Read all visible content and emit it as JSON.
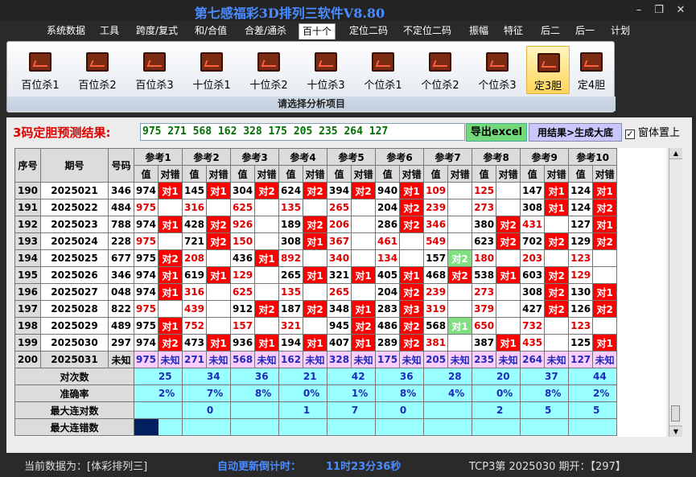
{
  "window": {
    "title": "第七感福彩3D排列三软件V8.80",
    "minimize": "–",
    "maximize": "❐",
    "close": "✕"
  },
  "menu": [
    "系统数据",
    "工具",
    "跨度/复式",
    "和/合值",
    "合差/通杀",
    "百十个",
    "定位二码",
    "不定位二码",
    "振幅",
    "特征",
    "后二",
    "后一",
    "计划"
  ],
  "menu_active": "百十个",
  "ribbon": {
    "buttons": [
      "百位杀1",
      "百位杀2",
      "百位杀3",
      "十位杀1",
      "十位杀2",
      "十位杀3",
      "个位杀1",
      "个位杀2",
      "个位杀3",
      "定3胆",
      "定4胆"
    ],
    "selected": "定3胆",
    "group_label": "请选择分析项目"
  },
  "result": {
    "label": "3码定胆预测结果:",
    "value": "975 271 568 162 328 175 205 235 264 127",
    "excel_button": "导出excel",
    "gen_button": "用结果>生成大底",
    "topmost_label": "窗体置上",
    "topmost_checked": "✓"
  },
  "table": {
    "header_top": [
      "序号",
      "期号",
      "号码",
      "参考1",
      "参考2",
      "参考3",
      "参考4",
      "参考5",
      "参考6",
      "参考7",
      "参考8",
      "参考9",
      "参考10"
    ],
    "header_sub": [
      "值",
      "对错"
    ],
    "rows": [
      {
        "seq": "190",
        "issue": "2025021",
        "num": "346",
        "refs": [
          [
            "974",
            "对1"
          ],
          [
            "145",
            "对1"
          ],
          [
            "304",
            "对2"
          ],
          [
            "624",
            "对2"
          ],
          [
            "394",
            "对2"
          ],
          [
            "940",
            "对1"
          ],
          [
            "109",
            ""
          ],
          [
            "125",
            ""
          ],
          [
            "147",
            "对1"
          ],
          [
            "124",
            "对1"
          ]
        ]
      },
      {
        "seq": "191",
        "issue": "2025022",
        "num": "484",
        "refs": [
          [
            "975",
            ""
          ],
          [
            "316",
            ""
          ],
          [
            "625",
            ""
          ],
          [
            "135",
            ""
          ],
          [
            "265",
            ""
          ],
          [
            "204",
            "对2"
          ],
          [
            "239",
            ""
          ],
          [
            "273",
            ""
          ],
          [
            "308",
            "对1"
          ],
          [
            "124",
            "对2"
          ]
        ]
      },
      {
        "seq": "192",
        "issue": "2025023",
        "num": "788",
        "refs": [
          [
            "974",
            "对1"
          ],
          [
            "428",
            "对2"
          ],
          [
            "926",
            ""
          ],
          [
            "189",
            "对2"
          ],
          [
            "206",
            ""
          ],
          [
            "286",
            "对2"
          ],
          [
            "346",
            ""
          ],
          [
            "380",
            "对2"
          ],
          [
            "431",
            ""
          ],
          [
            "127",
            "对1"
          ]
        ]
      },
      {
        "seq": "193",
        "issue": "2025024",
        "num": "228",
        "refs": [
          [
            "975",
            ""
          ],
          [
            "721",
            "对2"
          ],
          [
            "150",
            ""
          ],
          [
            "308",
            "对1"
          ],
          [
            "367",
            ""
          ],
          [
            "461",
            ""
          ],
          [
            "549",
            ""
          ],
          [
            "623",
            "对2"
          ],
          [
            "702",
            "对2"
          ],
          [
            "129",
            "对2"
          ]
        ]
      },
      {
        "seq": "194",
        "issue": "2025025",
        "num": "677",
        "refs": [
          [
            "975",
            "对2"
          ],
          [
            "208",
            ""
          ],
          [
            "436",
            "对1"
          ],
          [
            "892",
            ""
          ],
          [
            "340",
            ""
          ],
          [
            "134",
            ""
          ],
          [
            "157",
            "对2"
          ],
          [
            "180",
            ""
          ],
          [
            "203",
            ""
          ],
          [
            "123",
            ""
          ]
        ]
      },
      {
        "seq": "195",
        "issue": "2025026",
        "num": "346",
        "refs": [
          [
            "974",
            "对1"
          ],
          [
            "619",
            "对1"
          ],
          [
            "129",
            ""
          ],
          [
            "265",
            "对1"
          ],
          [
            "321",
            "对1"
          ],
          [
            "405",
            "对1"
          ],
          [
            "468",
            "对2"
          ],
          [
            "538",
            "对1"
          ],
          [
            "603",
            "对2"
          ],
          [
            "129",
            ""
          ]
        ]
      },
      {
        "seq": "196",
        "issue": "2025027",
        "num": "048",
        "refs": [
          [
            "974",
            "对1"
          ],
          [
            "316",
            ""
          ],
          [
            "625",
            ""
          ],
          [
            "135",
            ""
          ],
          [
            "265",
            ""
          ],
          [
            "204",
            "对2"
          ],
          [
            "239",
            ""
          ],
          [
            "273",
            ""
          ],
          [
            "308",
            "对2"
          ],
          [
            "130",
            "对1"
          ]
        ]
      },
      {
        "seq": "197",
        "issue": "2025028",
        "num": "822",
        "refs": [
          [
            "975",
            ""
          ],
          [
            "439",
            ""
          ],
          [
            "912",
            "对2"
          ],
          [
            "187",
            "对2"
          ],
          [
            "348",
            "对1"
          ],
          [
            "283",
            "对3"
          ],
          [
            "319",
            ""
          ],
          [
            "379",
            ""
          ],
          [
            "427",
            "对2"
          ],
          [
            "126",
            "对2"
          ]
        ]
      },
      {
        "seq": "198",
        "issue": "2025029",
        "num": "489",
        "refs": [
          [
            "975",
            "对1"
          ],
          [
            "752",
            ""
          ],
          [
            "157",
            ""
          ],
          [
            "321",
            ""
          ],
          [
            "945",
            "对2"
          ],
          [
            "486",
            "对2"
          ],
          [
            "568",
            "对1"
          ],
          [
            "650",
            ""
          ],
          [
            "732",
            ""
          ],
          [
            "123",
            ""
          ]
        ]
      },
      {
        "seq": "199",
        "issue": "2025030",
        "num": "297",
        "refs": [
          [
            "974",
            "对2"
          ],
          [
            "473",
            "对1"
          ],
          [
            "936",
            "对1"
          ],
          [
            "194",
            "对1"
          ],
          [
            "407",
            "对1"
          ],
          [
            "289",
            "对2"
          ],
          [
            "381",
            ""
          ],
          [
            "387",
            "对1"
          ],
          [
            "435",
            ""
          ],
          [
            "125",
            "对1"
          ]
        ]
      }
    ],
    "hit_colors": {
      "red": "#ff0000",
      "green": "#7ee07e"
    },
    "green_cells": [
      [
        4,
        6
      ],
      [
        8,
        6
      ]
    ],
    "prediction": {
      "seq": "200",
      "issue": "2025031",
      "num": "未知",
      "refs": [
        "975",
        "271",
        "568",
        "162",
        "328",
        "175",
        "205",
        "235",
        "264",
        "127"
      ],
      "status": "未知"
    },
    "stats": [
      {
        "label": "对次数",
        "values": [
          "125",
          "134",
          "136",
          "121",
          "142",
          "136",
          "128",
          "120",
          "137",
          "144"
        ]
      },
      {
        "label": "准确率",
        "values": [
          "62%",
          "67%",
          "68%",
          "60%",
          "71%",
          "68%",
          "64%",
          "60%",
          "68%",
          "72%"
        ]
      },
      {
        "label": "最大连对数",
        "values": [
          "9",
          "10",
          "7",
          "11",
          "17",
          "10",
          "9",
          "12",
          "15",
          "15"
        ]
      },
      {
        "label": "最大连错数",
        "values": [
          "6",
          "4",
          "3",
          "4",
          "4",
          "4",
          "4",
          "7",
          "6",
          "4"
        ]
      }
    ]
  },
  "status": {
    "current_label": "当前数据为：[体彩排列三]",
    "countdown_label": "自动更新倒计时：",
    "countdown_value": "11时23分36秒",
    "issue_label": "TCP3第 2025030 期开：【297】"
  }
}
